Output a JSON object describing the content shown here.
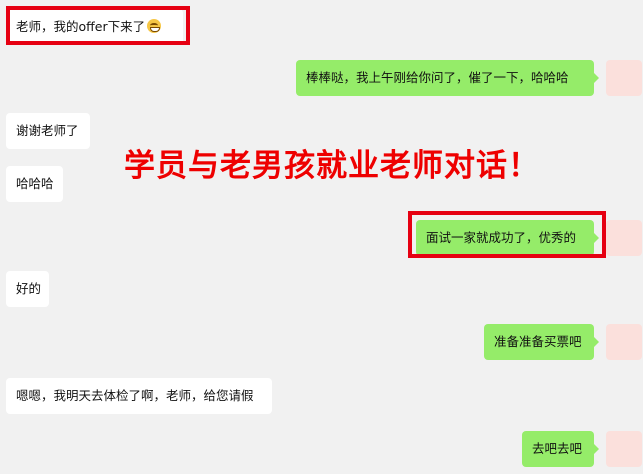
{
  "messages": [
    {
      "side": "left",
      "text": "老师，我的offer下来了",
      "emoji": "grinning-face-emoji"
    },
    {
      "side": "right",
      "text": "棒棒哒，我上午刚给你问了，催了一下，哈哈哈"
    },
    {
      "side": "left",
      "text": "谢谢老师了"
    },
    {
      "side": "left",
      "text": "哈哈哈"
    },
    {
      "side": "right",
      "text": "面试一家就成功了，优秀的"
    },
    {
      "side": "left",
      "text": "好的"
    },
    {
      "side": "right",
      "text": "准备准备买票吧"
    },
    {
      "side": "left",
      "text": "嗯嗯，我明天去体检了啊，老师，给您请假"
    },
    {
      "side": "right",
      "text": "去吧去吧"
    }
  ],
  "overlay_title": "学员与老男孩就业老师对话！",
  "colors": {
    "background": "#f1f1f1",
    "left_bubble": "#ffffff",
    "right_bubble": "#95ec69",
    "highlight_border": "#e60012",
    "overlay_title": "#ee0000",
    "avatar": "#fbe0dc"
  }
}
